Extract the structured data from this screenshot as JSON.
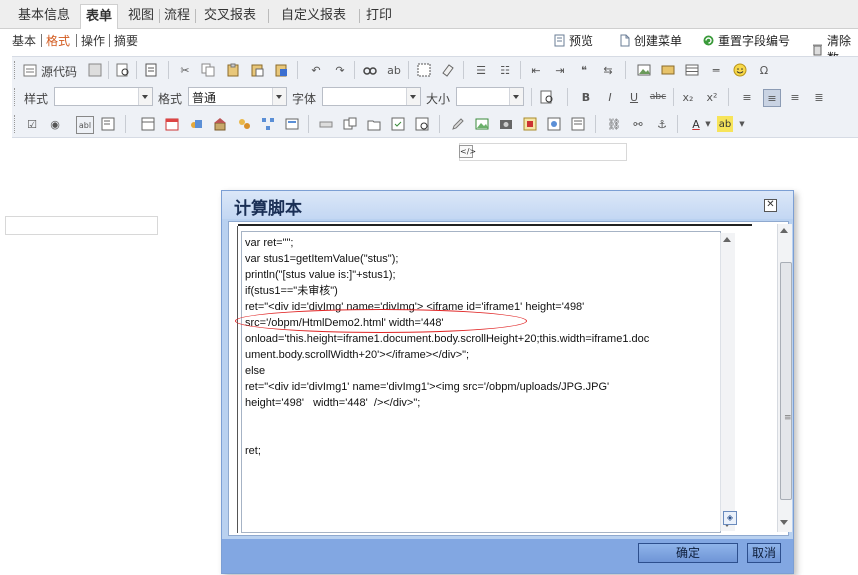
{
  "tabs": [
    {
      "label": "基本信息"
    },
    {
      "label": "表单",
      "active": true
    },
    {
      "label": "视图"
    },
    {
      "label": "流程"
    },
    {
      "label": "交叉报表"
    },
    {
      "label": "自定义报表"
    },
    {
      "label": "打印"
    }
  ],
  "subtabs": [
    {
      "label": "基本"
    },
    {
      "label": "格式",
      "active": true
    },
    {
      "label": "操作"
    },
    {
      "label": "摘要"
    }
  ],
  "tools": [
    {
      "label": "预览",
      "icon": "page-icon"
    },
    {
      "label": "创建菜单",
      "icon": "document-icon"
    },
    {
      "label": "重置字段编号",
      "icon": "refresh-icon"
    },
    {
      "label": "清除数",
      "icon": "trash-icon"
    }
  ],
  "toolbar": {
    "source_label": "源代码",
    "style_label": "样式",
    "format_label": "格式",
    "format_value": "普通",
    "font_label": "字体",
    "size_label": "大小"
  },
  "dialog": {
    "title": "计算脚本",
    "ok_label": "确定",
    "cancel_label": "取消",
    "code_lines": [
      "var ret=\"\";",
      "var stus1=getItemValue(\"stus\");",
      "println(\"[stus value is:]\"+stus1);",
      "if(stus1==\"未审核\")",
      "ret=\"<div id='divImg' name='divImg'> <iframe id='iframe1' height='498'",
      "src='/obpm/HtmlDemo2.html' width='448'",
      "onload='this.height=iframe1.document.body.scrollHeight+20;this.width=iframe1.doc",
      "ument.body.scrollWidth+20'></iframe></div>\";",
      "else",
      "ret=\"<div id='divImg1' name='divImg1'><img src='/obpm/uploads/JPG.JPG'",
      "height='498'   width='448'  /></div>\";",
      "",
      "",
      "ret;"
    ],
    "highlight_color": "#e02424"
  },
  "colors": {
    "accent": "#d25a1e",
    "dialog_bg": "#b9d1f0",
    "footer_bg": "#82a7e2"
  }
}
